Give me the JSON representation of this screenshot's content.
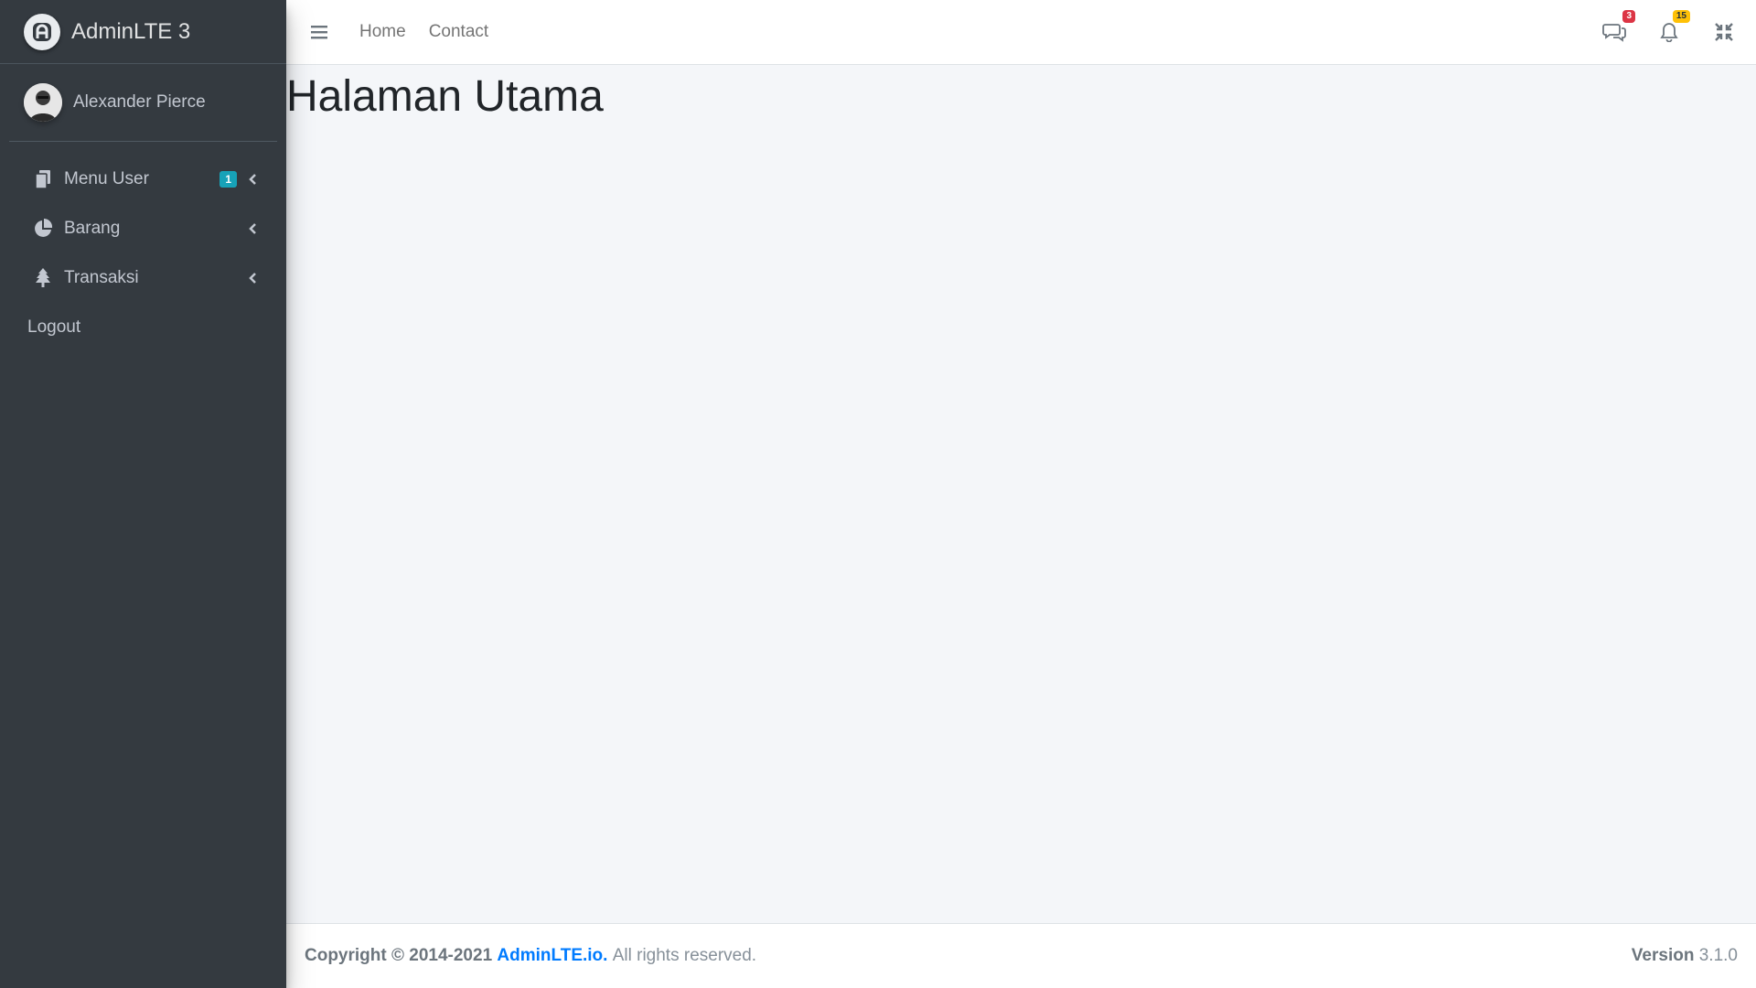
{
  "brand": {
    "name": "AdminLTE 3"
  },
  "user": {
    "name": "Alexander Pierce"
  },
  "sidebar": {
    "items": [
      {
        "label": "Menu User",
        "badge": "1",
        "icon": "copy-icon"
      },
      {
        "label": "Barang",
        "icon": "pie-chart-icon"
      },
      {
        "label": "Transaksi",
        "icon": "tree-icon"
      }
    ],
    "logout": "Logout"
  },
  "topbar": {
    "links": [
      "Home",
      "Contact"
    ],
    "messages_badge": "3",
    "notifications_badge": "15"
  },
  "main": {
    "title": "Halaman Utama"
  },
  "footer": {
    "copyright": "Copyright © 2014-2021",
    "link": "AdminLTE.io.",
    "rights": "All rights reserved.",
    "version_label": "Version",
    "version": "3.1.0"
  },
  "colors": {
    "sidebar_bg": "#343a40",
    "content_bg": "#f4f6f9",
    "badge_info": "#17a2b8",
    "badge_danger": "#dc3545",
    "badge_warning": "#ffc107",
    "link": "#007bff"
  }
}
